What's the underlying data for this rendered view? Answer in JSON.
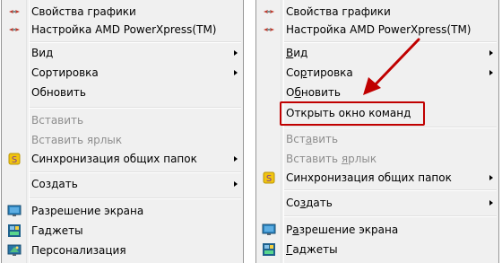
{
  "left_menu": {
    "graphics_properties": "Свойства графики",
    "amd_powerxpress": "Настройка AMD PowerXpress(TM)",
    "view": "Вид",
    "sort": "Сортировка",
    "refresh": "Обновить",
    "paste": "Вставить",
    "paste_shortcut": "Вставить ярлык",
    "sync_folders": "Синхронизация общих папок",
    "create": "Создать",
    "screen_resolution": "Разрешение экрана",
    "gadgets": "Гаджеты",
    "personalization": "Персонализация"
  },
  "right_menu": {
    "graphics_properties": "Свойства графики",
    "amd_powerxpress": "Настройка AMD PowerXpress(TM)",
    "view_first": "В",
    "view_rest": "ид",
    "sort_pre": "Со",
    "sort_u": "р",
    "sort_post": "тировка",
    "refresh_pre": "О",
    "refresh_u": "б",
    "refresh_post": "новить",
    "open_cmd_pre": "Открыть окно команд",
    "open_cmd_u": "",
    "open_cmd_post": "",
    "paste_pre": "Вст",
    "paste_u": "а",
    "paste_post": "вить",
    "paste_shortcut_pre": "Вставить ",
    "paste_shortcut_u": "я",
    "paste_shortcut_post": "рлык",
    "sync_folders": "Синхронизация общих папок",
    "create_pre": "Со",
    "create_u": "з",
    "create_post": "дать",
    "screen_resolution_pre": "Р",
    "screen_resolution_u": "а",
    "screen_resolution_post": "зрешение экрана",
    "gadgets_first": "Г",
    "gadgets_rest": "аджеты"
  },
  "colors": {
    "menu_bg": "#f0f0f0",
    "highlight_border": "#c00000",
    "arrow": "#c00000",
    "disabled_text": "#8e8e8e"
  },
  "icons": {
    "amd": "amd-logo-icon",
    "sync": "sync-center-icon",
    "screen": "monitor-icon",
    "gadgets": "gadgets-icon",
    "personalize": "personalization-icon"
  }
}
